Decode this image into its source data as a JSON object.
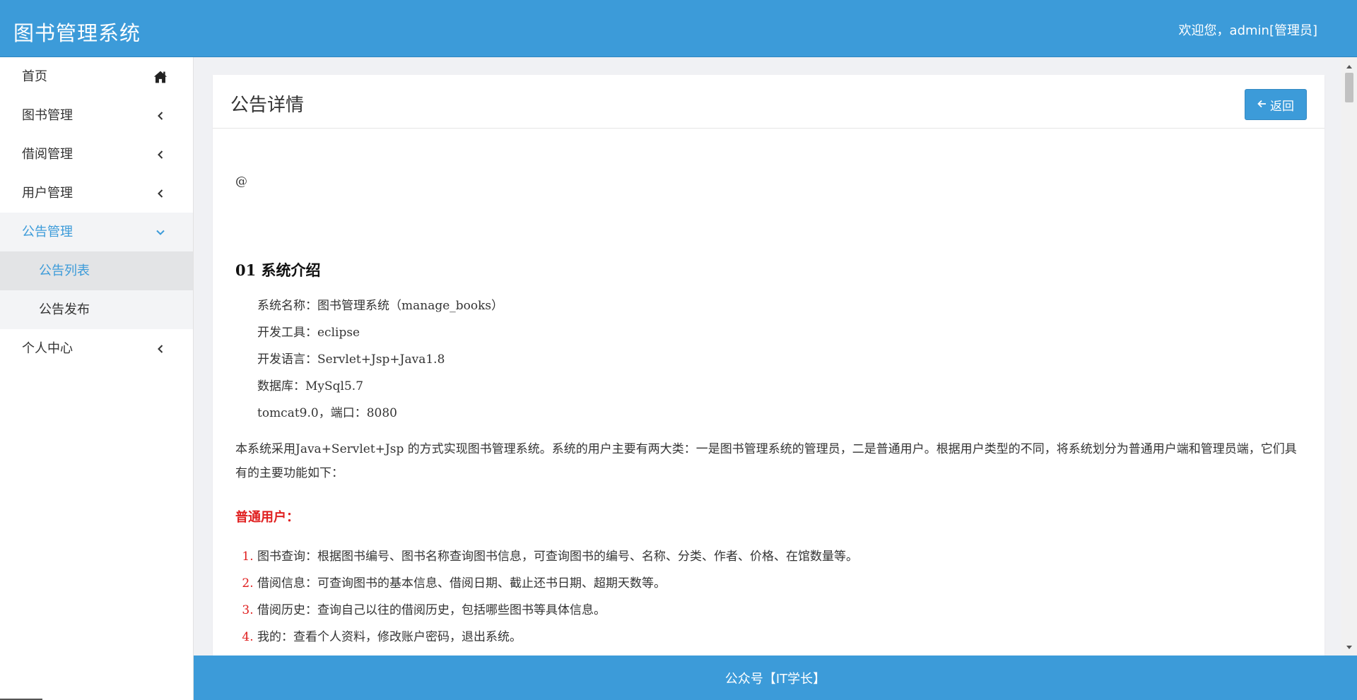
{
  "header": {
    "brand": "图书管理系统",
    "welcome": "欢迎您，admin[管理员]"
  },
  "sidebar": {
    "items": [
      {
        "label": "首页",
        "icon": "home-icon"
      },
      {
        "label": "图书管理",
        "icon": "chevron-left-icon"
      },
      {
        "label": "借阅管理",
        "icon": "chevron-left-icon"
      },
      {
        "label": "用户管理",
        "icon": "chevron-left-icon"
      },
      {
        "label": "公告管理",
        "icon": "chevron-down-icon",
        "expanded": true,
        "children": [
          {
            "label": "公告列表",
            "current": true
          },
          {
            "label": "公告发布"
          }
        ]
      },
      {
        "label": "个人中心",
        "icon": "chevron-left-icon"
      }
    ]
  },
  "card": {
    "title": "公告详情",
    "back_label": "返回"
  },
  "article": {
    "at": "@",
    "section_title": "01 系统介绍",
    "info": [
      "系统名称：图书管理系统（manage_books）",
      "开发工具：eclipse",
      "开发语言：Servlet+Jsp+Java1.8",
      "数据库：MySql5.7",
      "tomcat9.0，端口：8080"
    ],
    "intro": "本系统采用Java+Servlet+Jsp 的方式实现图书管理系统。系统的用户主要有两大类：一是图书管理系统的管理员，二是普通用户。根据用户类型的不同，将系统划分为普通用户端和管理员端，它们具有的主要功能如下：",
    "user_heading": "普通用户：",
    "features": [
      "图书查询：根据图书编号、图书名称查询图书信息，可查询图书的编号、名称、分类、作者、价格、在馆数量等。",
      "借阅信息：可查询图书的基本信息、借阅日期、截止还书日期、超期天数等。",
      "借阅历史：查询自己以往的借阅历史，包括哪些图书等具体信息。",
      "我的：查看个人资料，修改账户密码，退出系统。"
    ]
  },
  "footer": {
    "text": "公众号【IT学长】"
  },
  "colors": {
    "primary": "#3c9bd9",
    "accent_red": "#e02020"
  }
}
